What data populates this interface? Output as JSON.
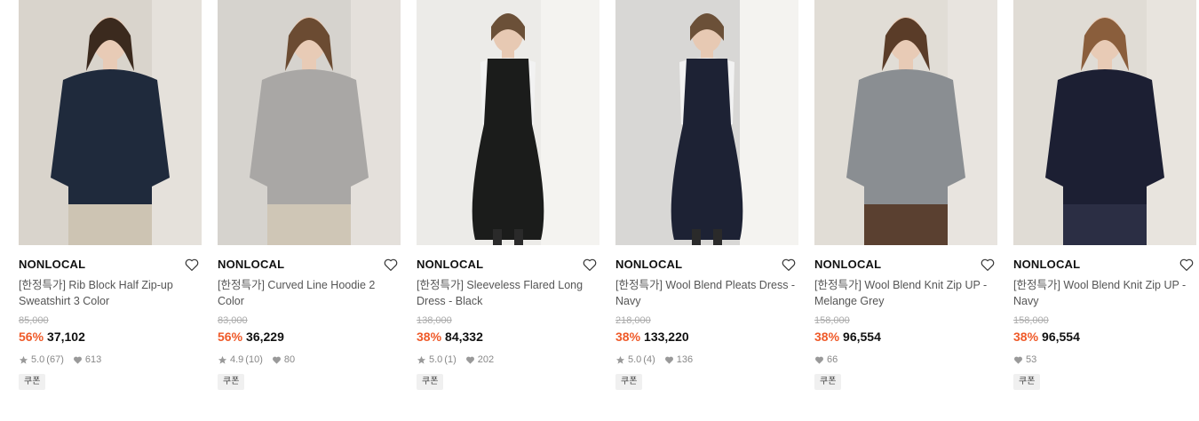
{
  "products": [
    {
      "brand": "NONLOCAL",
      "name": "[한정특가] Rib Block Half Zip-up Sweatshirt 3 Color",
      "original_price": "85,000",
      "discount": "56%",
      "price": "37,102",
      "rating": "5.0",
      "reviews": "(67)",
      "likes": "613",
      "coupon": "쿠폰",
      "photo": {
        "bg": "#d9d4cc",
        "top": "#1f2a3c",
        "bottom": "#cdc4b3",
        "hair": "#3b2a1e"
      }
    },
    {
      "brand": "NONLOCAL",
      "name": "[한정특가] Curved Line Hoodie 2 Color",
      "original_price": "83,000",
      "discount": "56%",
      "price": "36,229",
      "rating": "4.9",
      "reviews": "(10)",
      "likes": "80",
      "coupon": "쿠폰",
      "photo": {
        "bg": "#d6d3ce",
        "top": "#a9a7a5",
        "bottom": "#cfc6b6",
        "hair": "#6b4b32"
      }
    },
    {
      "brand": "NONLOCAL",
      "name": "[한정특가] Sleeveless Flared Long Dress - Black",
      "original_price": "138,000",
      "discount": "38%",
      "price": "84,332",
      "rating": "5.0",
      "reviews": "(1)",
      "likes": "202",
      "coupon": "쿠폰",
      "photo": {
        "bg": "#ecebe8",
        "top": "#1b1c1b",
        "bottom": "#1b1c1b",
        "hair": "#6b5038"
      }
    },
    {
      "brand": "NONLOCAL",
      "name": "[한정특가] Wool Blend Pleats Dress - Navy",
      "original_price": "218,000",
      "discount": "38%",
      "price": "133,220",
      "rating": "5.0",
      "reviews": "(4)",
      "likes": "136",
      "coupon": "쿠폰",
      "photo": {
        "bg": "#d8d7d5",
        "top": "#1d2234",
        "bottom": "#1d2234",
        "hair": "#6b5038"
      }
    },
    {
      "brand": "NONLOCAL",
      "name": "[한정특가] Wool Blend Knit Zip UP - Melange Grey",
      "original_price": "158,000",
      "discount": "38%",
      "price": "96,554",
      "rating": "",
      "reviews": "",
      "likes": "66",
      "coupon": "쿠폰",
      "photo": {
        "bg": "#e1ddd6",
        "top": "#8a8e92",
        "bottom": "#5a4030",
        "hair": "#5a3c28"
      }
    },
    {
      "brand": "NONLOCAL",
      "name": "[한정특가] Wool Blend Knit Zip UP - Navy",
      "original_price": "158,000",
      "discount": "38%",
      "price": "96,554",
      "rating": "",
      "reviews": "",
      "likes": "53",
      "coupon": "쿠폰",
      "photo": {
        "bg": "#e0dcd5",
        "top": "#1c1f33",
        "bottom": "#2b2e44",
        "hair": "#8a5e3c"
      }
    }
  ]
}
